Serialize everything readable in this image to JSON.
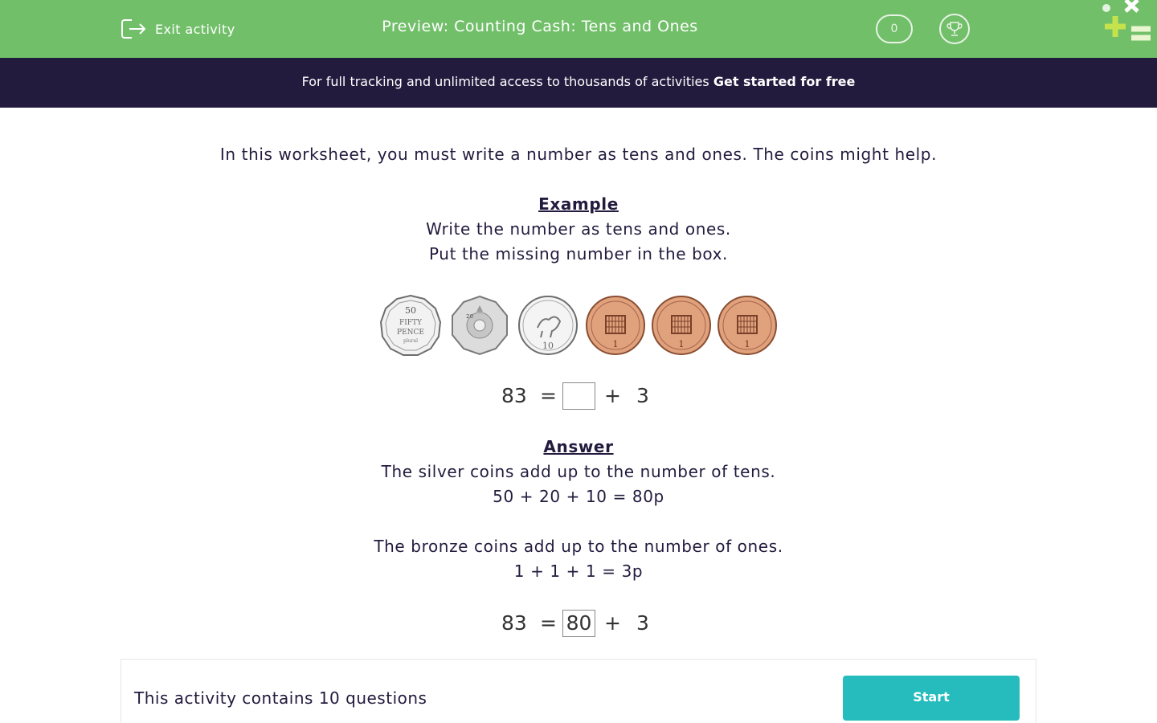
{
  "header": {
    "exit_label": "Exit activity",
    "title": "Preview: Counting Cash: Tens and Ones",
    "score": "0",
    "colors": {
      "bar": "#72bf6a",
      "banner": "#231b3e",
      "start": "#26bcbd"
    }
  },
  "banner": {
    "text": "For full tracking and unlimited access to thousands of activities ",
    "cta": "Get started for free"
  },
  "main": {
    "intro": "In this worksheet, you must write a number as tens and ones. The coins might help.",
    "example_heading": "Example",
    "example_lines": [
      "Write the number as tens and ones.",
      "Put the missing number in the box."
    ],
    "coins": [
      {
        "icon": "fifty-pence-coin-icon",
        "value": "50"
      },
      {
        "icon": "twenty-pence-coin-icon",
        "value": "20"
      },
      {
        "icon": "ten-pence-coin-icon",
        "value": "10"
      },
      {
        "icon": "one-penny-coin-icon",
        "value": "1"
      },
      {
        "icon": "one-penny-coin-icon",
        "value": "1"
      },
      {
        "icon": "one-penny-coin-icon",
        "value": "1"
      }
    ],
    "question_equation": {
      "left": "83",
      "equals": "=",
      "box": "",
      "plus": "+",
      "right": "3"
    },
    "answer_heading": "Answer",
    "answer_lines": [
      "The silver coins add up to the number of tens.",
      "50 + 20 + 10 = 80p",
      "The bronze coins add up to the number of ones.",
      "1 + 1 + 1 = 3p"
    ],
    "answer_equation": {
      "left": "83",
      "equals": "=",
      "box": "80",
      "plus": "+",
      "right": "3"
    }
  },
  "footer": {
    "text": "This activity contains 10 questions",
    "start_label": "Start"
  }
}
